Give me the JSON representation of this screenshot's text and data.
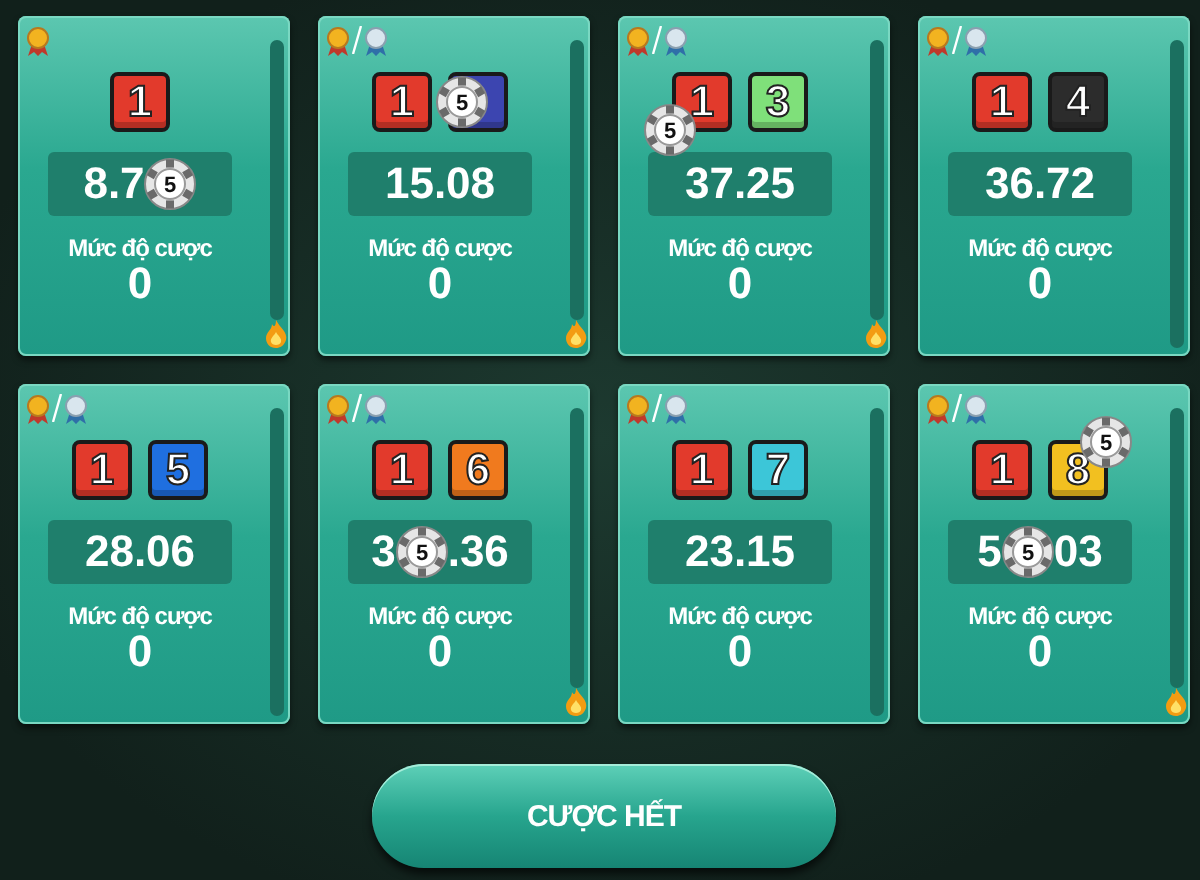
{
  "cards": [
    {
      "silver_medal": false,
      "flame": true,
      "dice": [
        {
          "value": "1",
          "color": "#e23a2c"
        }
      ],
      "odds": [
        "8.7"
      ],
      "odds_chip": "5",
      "label": "Mức độ cược",
      "bet": "0"
    },
    {
      "silver_medal": true,
      "flame": true,
      "dice": [
        {
          "value": "1",
          "color": "#e23a2c"
        },
        {
          "color": "#3c45b0",
          "chip": "5"
        }
      ],
      "odds": [
        "15.08"
      ],
      "label": "Mức độ cược",
      "bet": "0"
    },
    {
      "silver_medal": true,
      "flame": true,
      "dice": [
        {
          "value": "1",
          "color": "#e23a2c",
          "chip": "5"
        },
        {
          "value": "3",
          "color": "#7fe07a"
        }
      ],
      "odds": [
        "37.25"
      ],
      "label": "Mức độ cược",
      "bet": "0"
    },
    {
      "silver_medal": true,
      "flame": false,
      "dice": [
        {
          "value": "1",
          "color": "#e23a2c"
        },
        {
          "value": "4",
          "color": "#2c2c2c"
        }
      ],
      "odds": [
        "36.72"
      ],
      "label": "Mức độ cược",
      "bet": "0"
    },
    {
      "silver_medal": true,
      "flame": false,
      "dice": [
        {
          "value": "1",
          "color": "#e23a2c"
        },
        {
          "value": "5",
          "color": "#1f6fe0"
        }
      ],
      "odds": [
        "28.06"
      ],
      "label": "Mức độ cược",
      "bet": "0"
    },
    {
      "silver_medal": true,
      "flame": true,
      "dice": [
        {
          "value": "1",
          "color": "#e23a2c"
        },
        {
          "value": "6",
          "color": "#f07a1e"
        }
      ],
      "odds": [
        "3",
        ".36"
      ],
      "odds_chip": "5",
      "label": "Mức độ cược",
      "bet": "0"
    },
    {
      "silver_medal": true,
      "flame": false,
      "dice": [
        {
          "value": "1",
          "color": "#e23a2c"
        },
        {
          "value": "7",
          "color": "#3cc6d8"
        }
      ],
      "odds": [
        "23.15"
      ],
      "label": "Mức độ cược",
      "bet": "0"
    },
    {
      "silver_medal": true,
      "flame": true,
      "dice": [
        {
          "value": "1",
          "color": "#e23a2c"
        },
        {
          "value": "8",
          "color": "#f2c020",
          "chip": "5"
        }
      ],
      "odds": [
        "5",
        "03"
      ],
      "odds_chip": "5",
      "label": "Mức độ cược",
      "bet": "0"
    }
  ],
  "bet_all_button": "CƯỢC HẾT"
}
